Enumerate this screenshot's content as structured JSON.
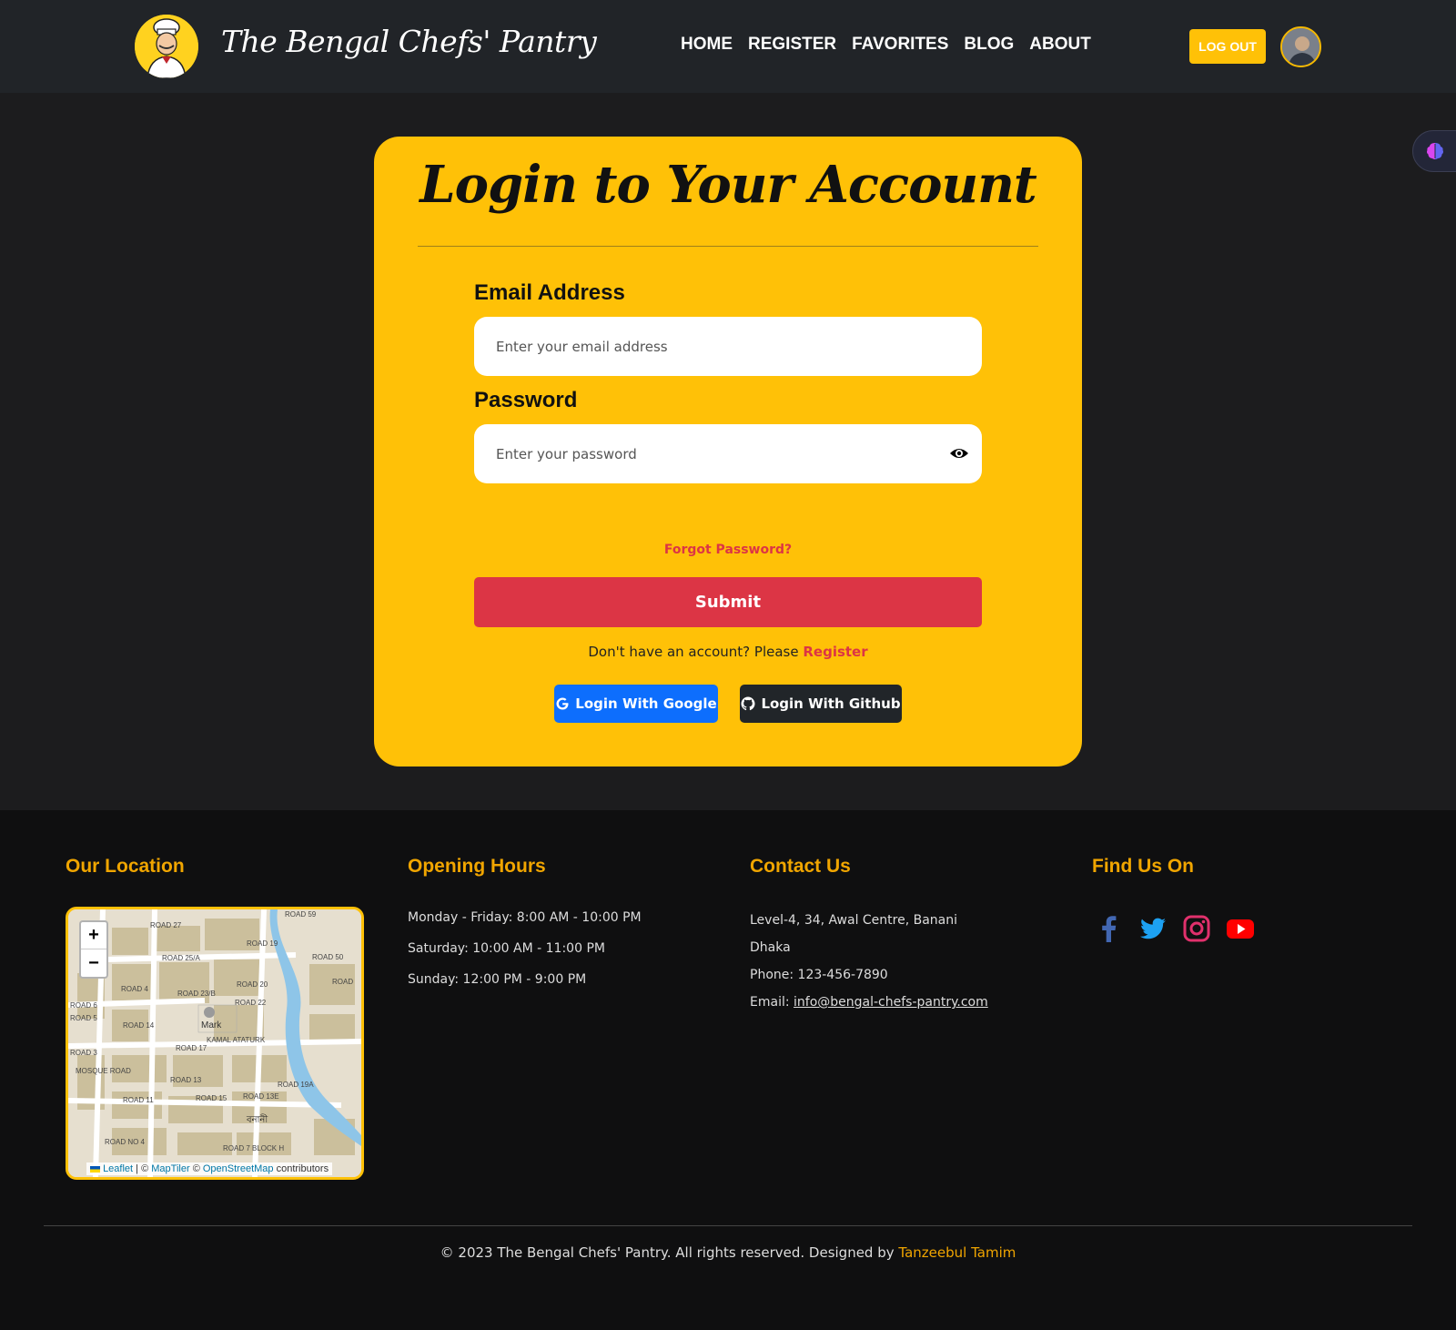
{
  "header": {
    "brand": "The Bengal Chefs' Pantry",
    "nav": [
      "HOME",
      "REGISTER",
      "FAVORITES",
      "BLOG",
      "ABOUT"
    ],
    "logout_label": "LOG OUT"
  },
  "login": {
    "title": "Login to Your Account",
    "email_label": "Email Address",
    "email_placeholder": "Enter your email address",
    "password_label": "Password",
    "password_placeholder": "Enter your password",
    "forgot_label": "Forgot Password?",
    "submit_label": "Submit",
    "register_prompt": "Don't have an account? Please",
    "register_link": "Register",
    "google_label": "Login With Google",
    "github_label": "Login With Github"
  },
  "footer": {
    "location_heading": "Our Location",
    "hours_heading": "Opening Hours",
    "hours": [
      "Monday - Friday: 8:00 AM - 10:00 PM",
      "Saturday: 10:00 AM - 11:00 PM",
      "Sunday: 12:00 PM - 9:00 PM"
    ],
    "contact_heading": "Contact Us",
    "address_line1": "Level-4, 34, Awal Centre, Banani",
    "address_line2": "Dhaka",
    "phone": "Phone: 123-456-7890",
    "email_prefix": "Email:",
    "email": "info@bengal-chefs-pantry.com",
    "social_heading": "Find Us On",
    "social_icons": [
      "facebook-icon",
      "twitter-icon",
      "instagram-icon",
      "youtube-icon"
    ],
    "copyright_prefix": "© 2023 The Bengal Chefs' Pantry. All rights reserved. Designed by",
    "designer": "Tanzeebul Tamim"
  },
  "map": {
    "zoom_in": "+",
    "zoom_out": "−",
    "attribution_leaflet": "Leaflet",
    "attribution_sep": "|  ©",
    "attribution_maptiler": "MapTiler",
    "attribution_copy": "©",
    "attribution_osm": "OpenStreetMap",
    "attribution_contributors": "contributors",
    "marker_label": "Mark",
    "road_labels": [
      "ROAD 27",
      "ROAD 59",
      "ROAD 25/A",
      "ROAD 20",
      "ROAD 22",
      "ROAD 17",
      "KAMAL ATATURK",
      "ROAD 13",
      "ROAD 11",
      "ROAD 13E",
      "ROAD 7 BLOCK H",
      "ROAD 50",
      "ROAD",
      "ROAD 5",
      "ROAD 3",
      "ROAD 6",
      "ROAD 4",
      "ROAD 14",
      "ROAD 23/B",
      "ROAD 19",
      "ROAD 15",
      "ROAD 19A",
      "MOSQUE ROAD",
      "ROAD NO 4",
      "বনানী"
    ]
  },
  "colors": {
    "accent": "#ffc107",
    "danger": "#dc3545",
    "google": "#0d6efd",
    "github": "#212529",
    "footer_heading": "#f0a500"
  }
}
